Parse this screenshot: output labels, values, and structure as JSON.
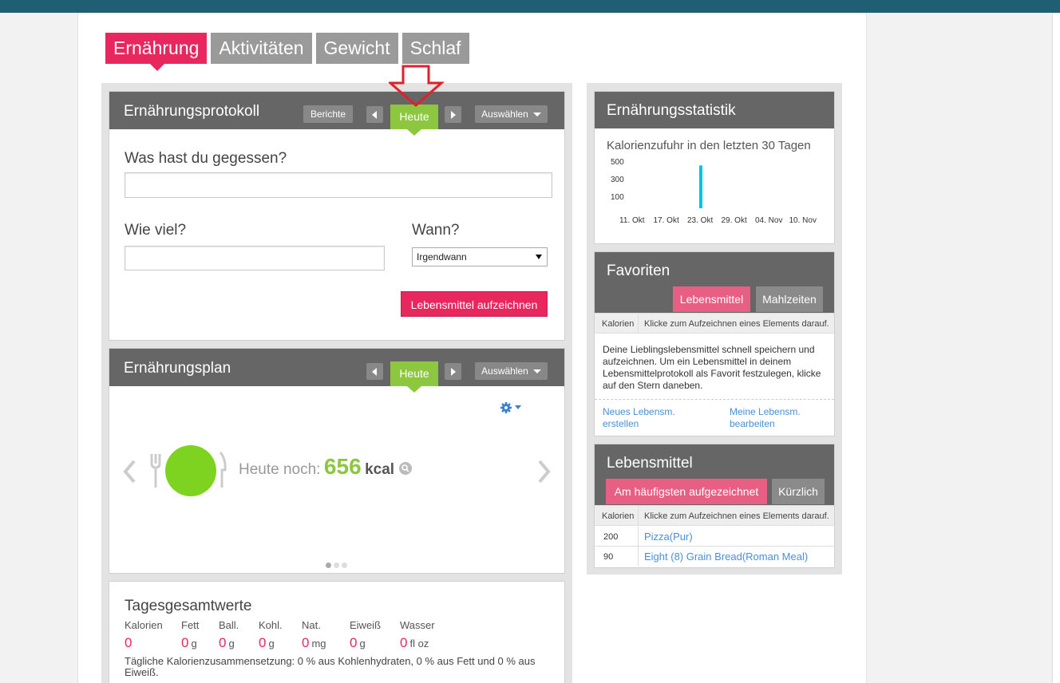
{
  "tabs": [
    "Ernährung",
    "Aktivitäten",
    "Gewicht",
    "Schlaf"
  ],
  "protokoll": {
    "title": "Ernährungsprotokoll",
    "berichte": "Berichte",
    "heute": "Heute",
    "auswaehlen": "Auswählen",
    "question": "Was hast du gegessen?",
    "wieviel": "Wie viel?",
    "wann": "Wann?",
    "wann_value": "Irgendwann",
    "submit": "Lebensmittel aufzeichnen"
  },
  "plan": {
    "title": "Ernährungsplan",
    "heute": "Heute",
    "auswaehlen": "Auswählen",
    "remaining_label": "Heute noch:",
    "remaining_value": "656",
    "remaining_unit": "kcal"
  },
  "totals": {
    "title": "Tagesgesamtwerte",
    "columns": [
      {
        "label": "Kalorien",
        "value": "0",
        "unit": ""
      },
      {
        "label": "Fett",
        "value": "0",
        "unit": "g"
      },
      {
        "label": "Ball.",
        "value": "0",
        "unit": "g"
      },
      {
        "label": "Kohl.",
        "value": "0",
        "unit": "g"
      },
      {
        "label": "Nat.",
        "value": "0",
        "unit": "mg"
      },
      {
        "label": "Eiweiß",
        "value": "0",
        "unit": "g"
      },
      {
        "label": "Wasser",
        "value": "0",
        "unit": "fl oz"
      }
    ],
    "composition": "Tägliche Kalorienzusammensetzung: 0 % aus Kohlenhydraten, 0 % aus Fett und 0 % aus Eiweiß."
  },
  "stats": {
    "title": "Ernährungsstatistik",
    "subtitle": "Kalorienzufuhr in den letzten 30 Tagen"
  },
  "chart_data": {
    "type": "bar",
    "title": "Kalorienzufuhr in den letzten 30 Tagen",
    "y_ticks": [
      "500",
      "300",
      "100"
    ],
    "x_ticks": [
      "11. Okt",
      "17. Okt",
      "23. Okt",
      "29. Okt",
      "04. Nov",
      "10. Nov"
    ],
    "bars": [
      {
        "date": "23. Okt",
        "value": 500
      }
    ],
    "ylim": [
      0,
      550
    ],
    "bar_color": "#00c3e6"
  },
  "favoriten": {
    "title": "Favoriten",
    "tab_lebensmittel": "Lebensmittel",
    "tab_mahlzeiten": "Mahlzeiten",
    "col_kalorien": "Kalorien",
    "col_hint": "Klicke zum Aufzeichnen eines Elements darauf.",
    "info": "Deine Lieblingslebensmittel schnell speichern und aufzeichnen. Um ein Lebensmittel in deinem Lebensmittelprotokoll als Favorit festzulegen, klicke auf den Stern daneben.",
    "link_new": "Neues Lebensm. erstellen",
    "link_edit": "Meine Lebensm. bearbeiten"
  },
  "lebensmittel": {
    "title": "Lebensmittel",
    "tab_haeufig": "Am häufigsten aufgezeichnet",
    "tab_kuerzlich": "Kürzlich",
    "col_kalorien": "Kalorien",
    "col_hint": "Klicke zum Aufzeichnen eines Elements darauf.",
    "rows": [
      {
        "kcal": "200",
        "name": "Pizza(Pur)"
      },
      {
        "kcal": "90",
        "name": "Eight (8) Grain Bread(Roman Meal)"
      }
    ]
  },
  "colors": {
    "accent": "#e8275f",
    "green": "#8dc63f",
    "header": "#666666"
  }
}
